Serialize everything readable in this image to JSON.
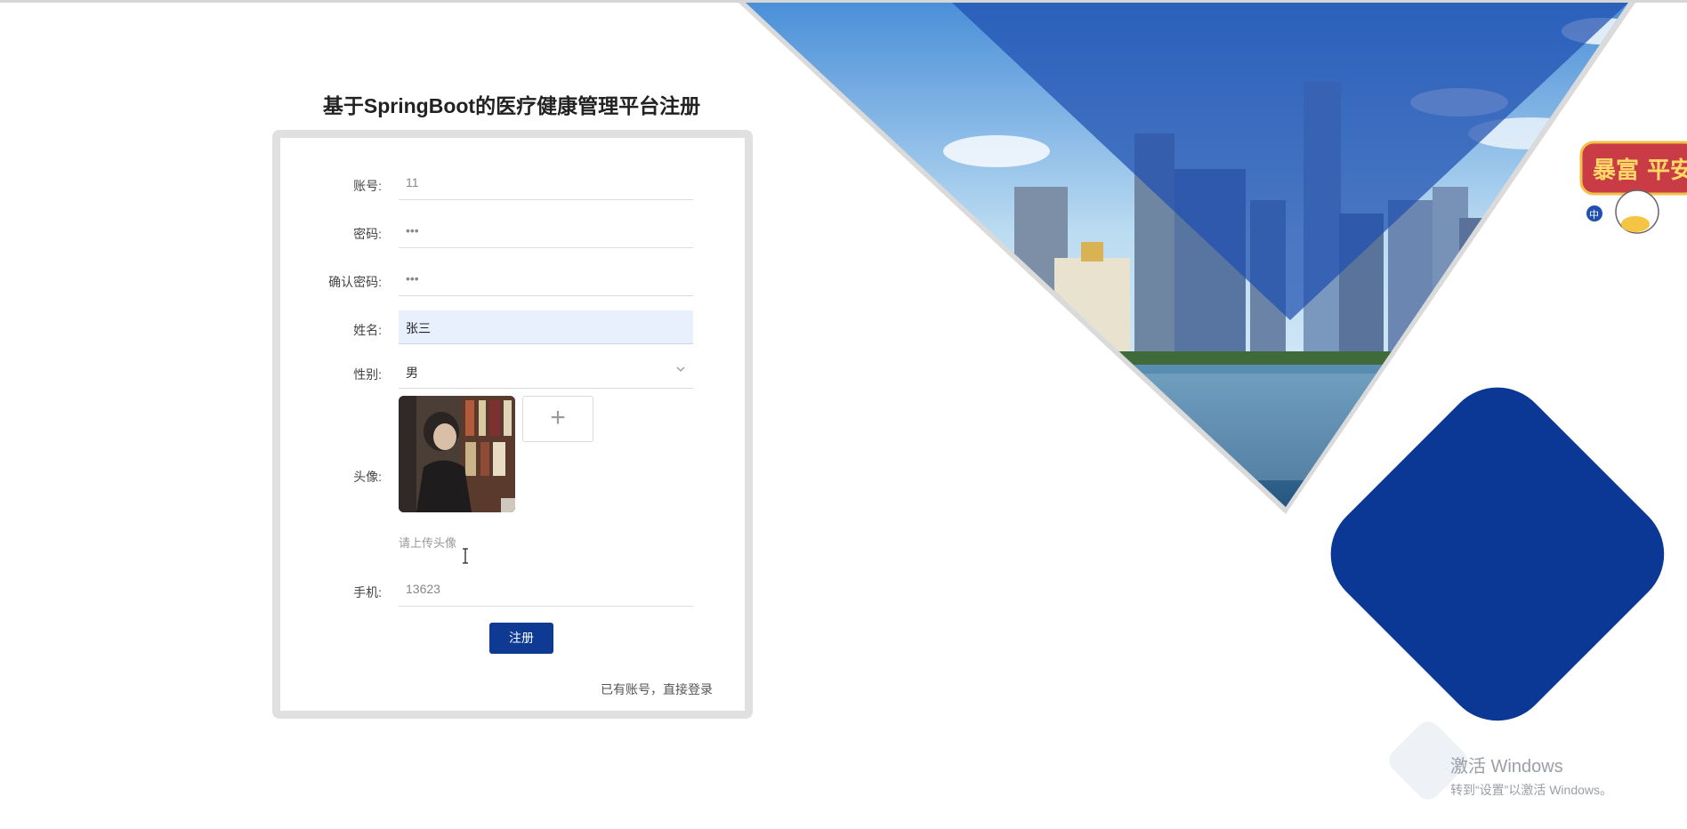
{
  "page": {
    "title": "基于SpringBoot的医疗健康管理平台注册"
  },
  "form": {
    "account": {
      "label": "账号:",
      "value": "11"
    },
    "password": {
      "label": "密码:",
      "value": "•••"
    },
    "confirm_password": {
      "label": "确认密码:",
      "value": "•••"
    },
    "name": {
      "label": "姓名:",
      "value": "张三"
    },
    "gender": {
      "label": "性别:",
      "value": "男"
    },
    "avatar": {
      "label": "头像:",
      "upload_symbol": "+",
      "hint": "请上传头像"
    },
    "phone": {
      "label": "手机:",
      "value": "13623"
    },
    "submit_label": "注册",
    "login_link": "已有账号，直接登录"
  },
  "banner": {
    "sticker_text": "暴富 平安",
    "sticker_small": "中"
  },
  "watermark": {
    "title": "激活 Windows",
    "subtitle": "转到“设置”以激活 Windows。"
  },
  "colors": {
    "primary": "#0e3a93",
    "accent_diamond": "#0b3795",
    "field_filled": "#e8f0fe"
  },
  "icons": [
    "chevron-down-icon",
    "plus-icon",
    "text-cursor-icon"
  ]
}
